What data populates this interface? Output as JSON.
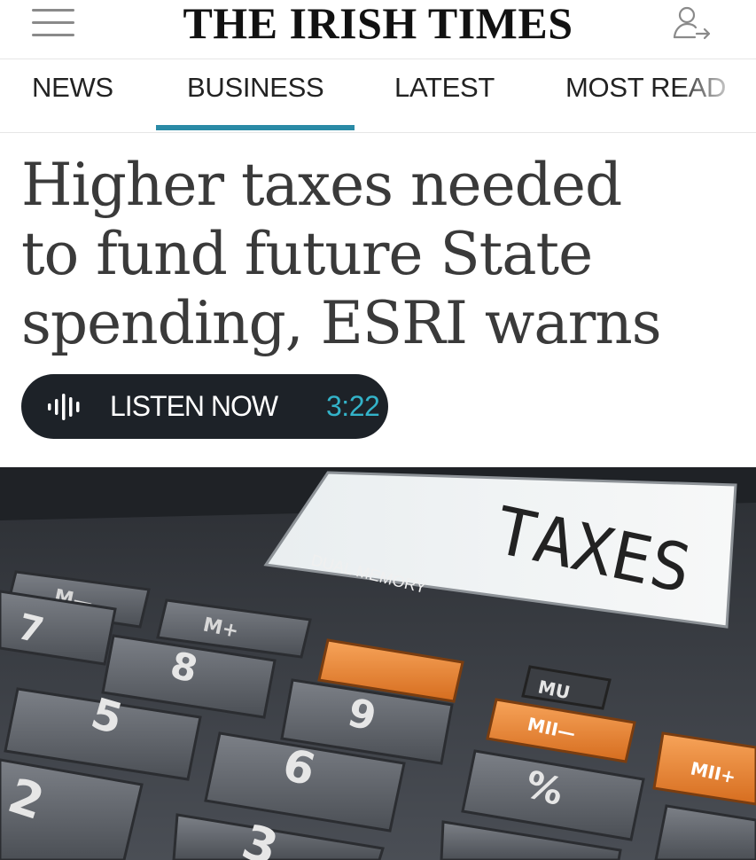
{
  "header": {
    "masthead": "THE IRISH TIMES",
    "menu_icon": "hamburger-menu-icon",
    "account_icon": "user-arrow-icon"
  },
  "nav": {
    "items": [
      {
        "label": "NEWS"
      },
      {
        "label": "BUSINESS"
      },
      {
        "label": "LATEST"
      },
      {
        "label": "MOST READ"
      }
    ],
    "active": "BUSINESS",
    "accent_color": "#2a8aa6"
  },
  "article": {
    "headline_lines": [
      "Higher taxes needed",
      "to fund future State",
      "spending, ESRI warns"
    ],
    "listen": {
      "icon": "audio-wave-icon",
      "label": "LISTEN NOW",
      "duration": "3:22",
      "duration_color": "#33b3c9"
    }
  },
  "image": {
    "display_text": "TAXES",
    "panel_text": "DUAL MEMORY",
    "keys": [
      "M—",
      "M+",
      "MU",
      "MII—",
      "7",
      "8",
      "9",
      "5",
      "6",
      "2",
      "3",
      "%",
      "MII+"
    ]
  }
}
